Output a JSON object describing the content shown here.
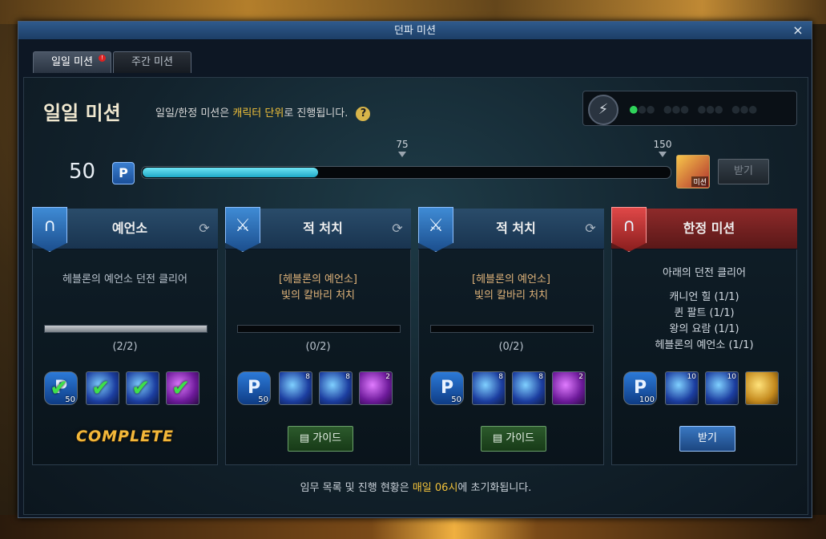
{
  "window": {
    "title": "던파 미션",
    "close_glyph": "×"
  },
  "tabs": [
    {
      "label": "일일 미션",
      "active": true,
      "alert": "!"
    },
    {
      "label": "주간 미션",
      "active": false
    }
  ],
  "header": {
    "title": "일일 미션",
    "desc_pre": "일일/한정 미션은 ",
    "desc_hl": "캐릭터 단위",
    "desc_post": "로 진행됩니다.",
    "help": "?"
  },
  "fatigue": {
    "icon": "lightning-icon",
    "active_dots": 1,
    "total_dots": 13
  },
  "points": {
    "current": "50",
    "badge": "P",
    "max": 150,
    "progress_fraction": 0.333,
    "milestones": [
      "75",
      "150"
    ],
    "reward_label": "미션",
    "claim_label": "받기"
  },
  "cards": [
    {
      "title": "예언소",
      "color": "blue",
      "desc": "헤블론의 예언소 던전 클리어",
      "progress_text": "(2/2)",
      "progress_fraction": 1.0,
      "items": [
        {
          "type": "p",
          "count": "50",
          "checked": true
        },
        {
          "type": "orb",
          "count": "",
          "checked": true
        },
        {
          "type": "orb",
          "count": "",
          "checked": true
        },
        {
          "type": "purple",
          "count": "",
          "checked": true
        }
      ],
      "status": "COMPLETE"
    },
    {
      "title": "적 처치",
      "color": "blue",
      "desc_line1": "[헤블론의 예언소]",
      "desc_line2": "빛의 칼바리 처치",
      "progress_text": "(0/2)",
      "progress_fraction": 0,
      "items": [
        {
          "type": "p",
          "count": "50"
        },
        {
          "type": "orb",
          "count": "8"
        },
        {
          "type": "orb",
          "count": "8"
        },
        {
          "type": "purple",
          "count": "2"
        }
      ],
      "action": "가이드"
    },
    {
      "title": "적 처치",
      "color": "blue",
      "desc_line1": "[헤블론의 예언소]",
      "desc_line2": "빛의 칼바리 처치",
      "progress_text": "(0/2)",
      "progress_fraction": 0,
      "items": [
        {
          "type": "p",
          "count": "50"
        },
        {
          "type": "orb",
          "count": "8"
        },
        {
          "type": "orb",
          "count": "8"
        },
        {
          "type": "purple",
          "count": "2"
        }
      ],
      "action": "가이드"
    },
    {
      "title": "한정 미션",
      "color": "red",
      "desc": "아래의 던전 클리어",
      "dungeons": [
        "캐니언 힐 (1/1)",
        "퀸 팔트 (1/1)",
        "왕의 요람 (1/1)",
        "헤블론의 예언소 (1/1)"
      ],
      "items": [
        {
          "type": "p",
          "count": "100"
        },
        {
          "type": "orb",
          "count": "10"
        },
        {
          "type": "orb",
          "count": "10"
        },
        {
          "type": "gold",
          "count": ""
        }
      ],
      "action": "받기"
    }
  ],
  "footer": {
    "pre": "임무 목록 및 진행 현황은 ",
    "hl": "매일 06시",
    "post": "에 초기화됩니다."
  },
  "colors": {
    "accent": "#f2c23a",
    "progress": "#1fa9c6",
    "dot_on": "#2fd35a"
  }
}
